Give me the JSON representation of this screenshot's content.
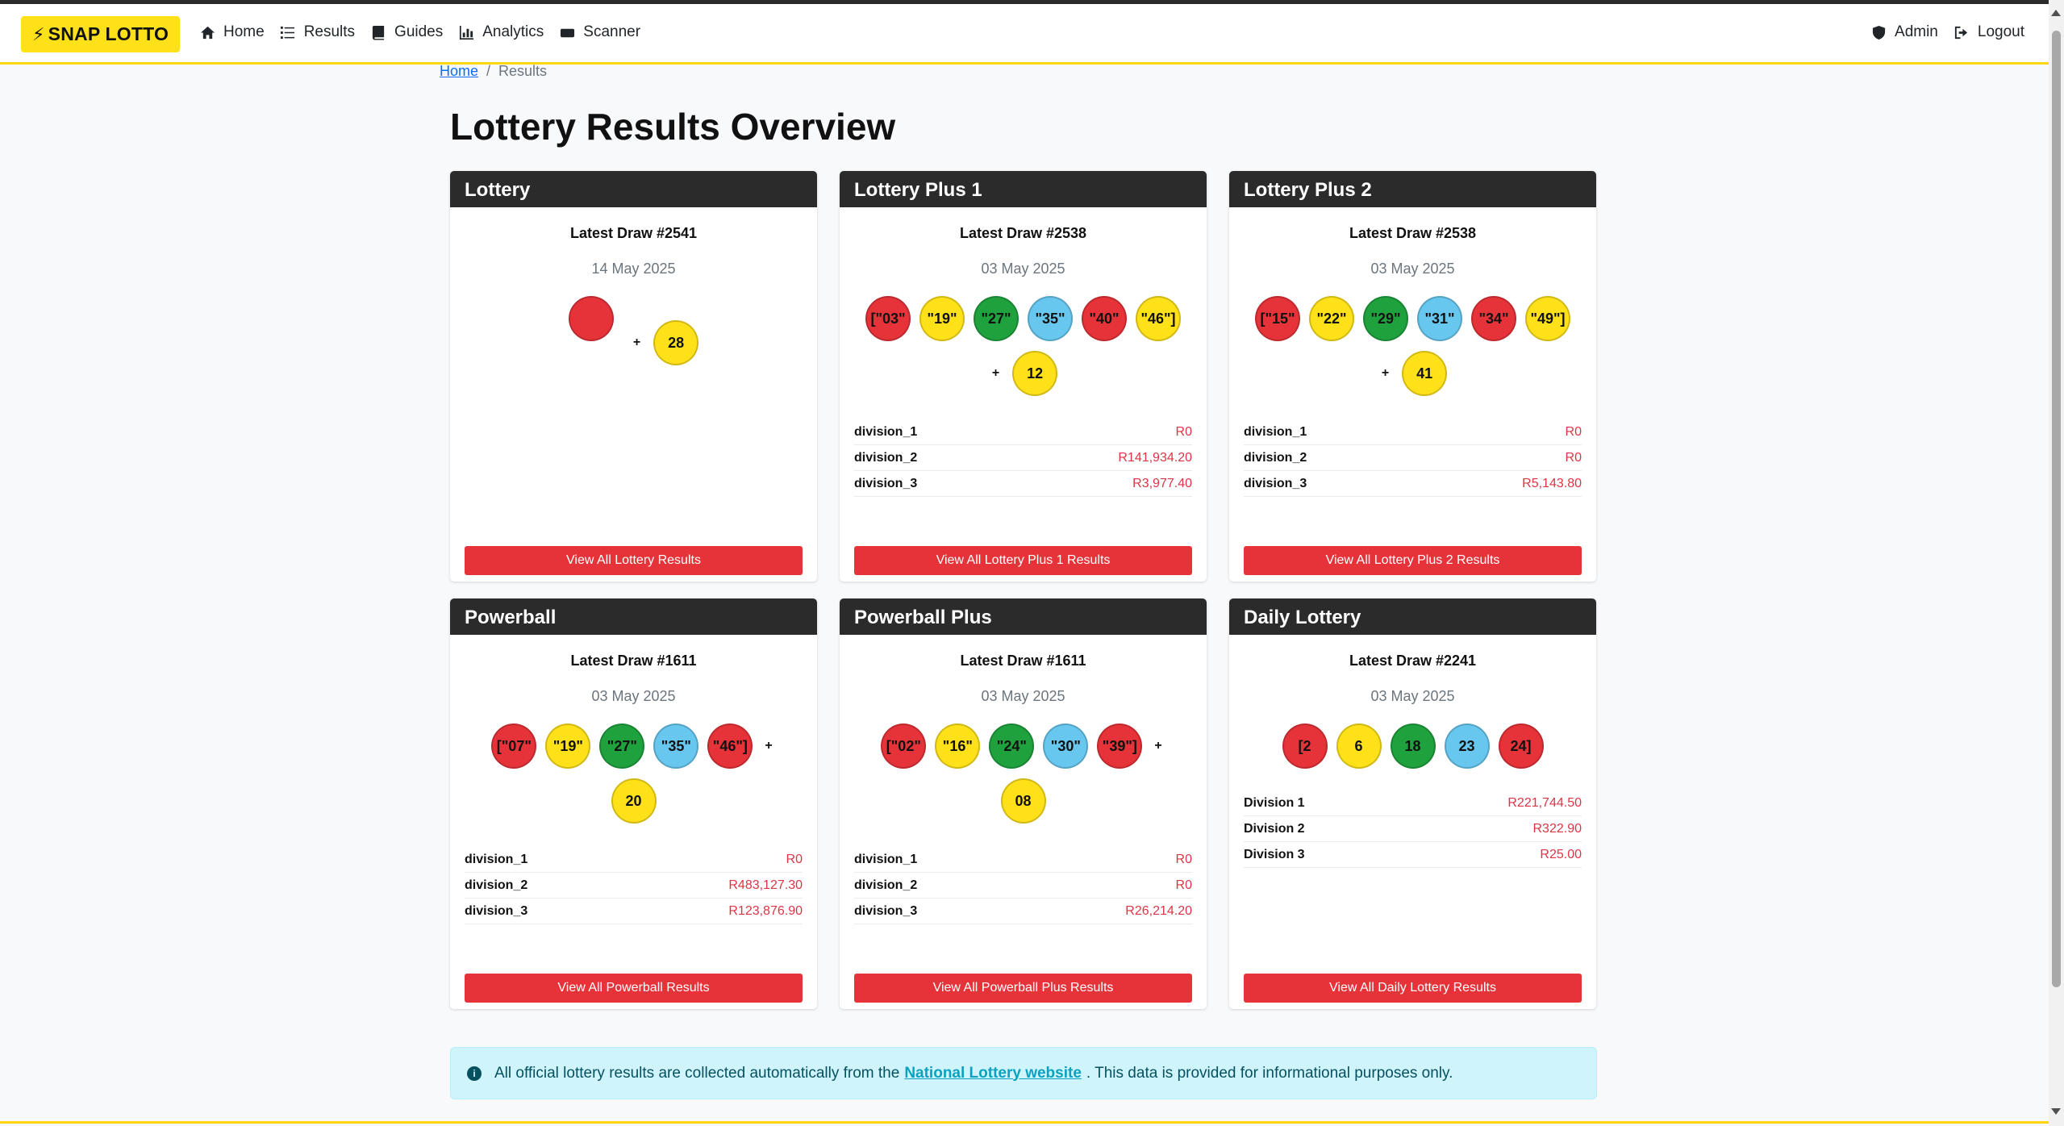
{
  "brand": {
    "label": "SNAP LOTTO"
  },
  "nav": {
    "links": [
      {
        "label": "Home",
        "icon": "home-icon"
      },
      {
        "label": "Results",
        "icon": "list-icon"
      },
      {
        "label": "Guides",
        "icon": "book-icon"
      },
      {
        "label": "Analytics",
        "icon": "chart-icon"
      },
      {
        "label": "Scanner",
        "icon": "scanner-icon"
      }
    ],
    "right": [
      {
        "label": "Admin",
        "icon": "shield-icon"
      },
      {
        "label": "Logout",
        "icon": "logout-icon"
      }
    ]
  },
  "breadcrumb": {
    "home": "Home",
    "separator": "/",
    "current": "Results"
  },
  "page": {
    "title": "Lottery Results Overview"
  },
  "cards": [
    {
      "title": "Lottery",
      "draw": "Latest Draw #2541",
      "date": "14 May 2025",
      "balls": [
        ""
      ],
      "bonus": "28",
      "prizes": [],
      "button": "View All Lottery Results"
    },
    {
      "title": "Lottery Plus 1",
      "draw": "Latest Draw #2538",
      "date": "03 May 2025",
      "balls": [
        "[\"03\"",
        "\"19\"",
        "\"27\"",
        "\"35\"",
        "\"40\"",
        "\"46\"]"
      ],
      "bonus": "12",
      "prizes": [
        {
          "division": "division_1",
          "amount": "R0"
        },
        {
          "division": "division_2",
          "amount": "R141,934.20"
        },
        {
          "division": "division_3",
          "amount": "R3,977.40"
        }
      ],
      "button": "View All Lottery Plus 1 Results"
    },
    {
      "title": "Lottery Plus 2",
      "draw": "Latest Draw #2538",
      "date": "03 May 2025",
      "balls": [
        "[\"15\"",
        "\"22\"",
        "\"29\"",
        "\"31\"",
        "\"34\"",
        "\"49\"]"
      ],
      "bonus": "41",
      "prizes": [
        {
          "division": "division_1",
          "amount": "R0"
        },
        {
          "division": "division_2",
          "amount": "R0"
        },
        {
          "division": "division_3",
          "amount": "R5,143.80"
        }
      ],
      "button": "View All Lottery Plus 2 Results"
    },
    {
      "title": "Powerball",
      "draw": "Latest Draw #1611",
      "date": "03 May 2025",
      "balls": [
        "[\"07\"",
        "\"19\"",
        "\"27\"",
        "\"35\"",
        "\"46\"]"
      ],
      "bonus": "20",
      "prizes": [
        {
          "division": "division_1",
          "amount": "R0"
        },
        {
          "division": "division_2",
          "amount": "R483,127.30"
        },
        {
          "division": "division_3",
          "amount": "R123,876.90"
        }
      ],
      "button": "View All Powerball Results"
    },
    {
      "title": "Powerball Plus",
      "draw": "Latest Draw #1611",
      "date": "03 May 2025",
      "balls": [
        "[\"02\"",
        "\"16\"",
        "\"24\"",
        "\"30\"",
        "\"39\"]"
      ],
      "bonus": "08",
      "prizes": [
        {
          "division": "division_1",
          "amount": "R0"
        },
        {
          "division": "division_2",
          "amount": "R0"
        },
        {
          "division": "division_3",
          "amount": "R26,214.20"
        }
      ],
      "button": "View All Powerball Plus Results"
    },
    {
      "title": "Daily Lottery",
      "draw": "Latest Draw #2241",
      "date": "03 May 2025",
      "balls": [
        "[2",
        "6",
        "18",
        "23",
        "24]"
      ],
      "bonus": null,
      "prizes": [
        {
          "division": "Division 1",
          "amount": "R221,744.50"
        },
        {
          "division": "Division 2",
          "amount": "R322.90"
        },
        {
          "division": "Division 3",
          "amount": "R25.00"
        }
      ],
      "button": "View All Daily Lottery Results"
    }
  ],
  "info": {
    "text_before": "All official lottery results are collected automatically from the",
    "link": "National Lottery website",
    "text_after": ". This data is provided for informational purposes only."
  },
  "colors": {
    "brand": "#ffe11a",
    "header_dark": "#2b2b2b",
    "button_red": "#e63339",
    "ball_cycle": [
      "red",
      "yellow",
      "green",
      "blue",
      "red",
      "yellow"
    ]
  }
}
